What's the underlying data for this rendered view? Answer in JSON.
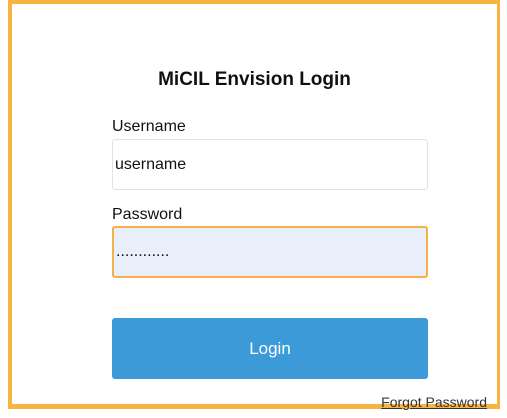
{
  "form": {
    "title": "MiCIL Envision Login",
    "username_label": "Username",
    "username_value": "username",
    "password_label": "Password",
    "password_value": "............",
    "login_label": "Login",
    "forgot_label": "Forgot Password"
  },
  "colors": {
    "accent_border": "#f6b443",
    "button": "#3c9ad9",
    "password_fill": "#e8effa"
  }
}
